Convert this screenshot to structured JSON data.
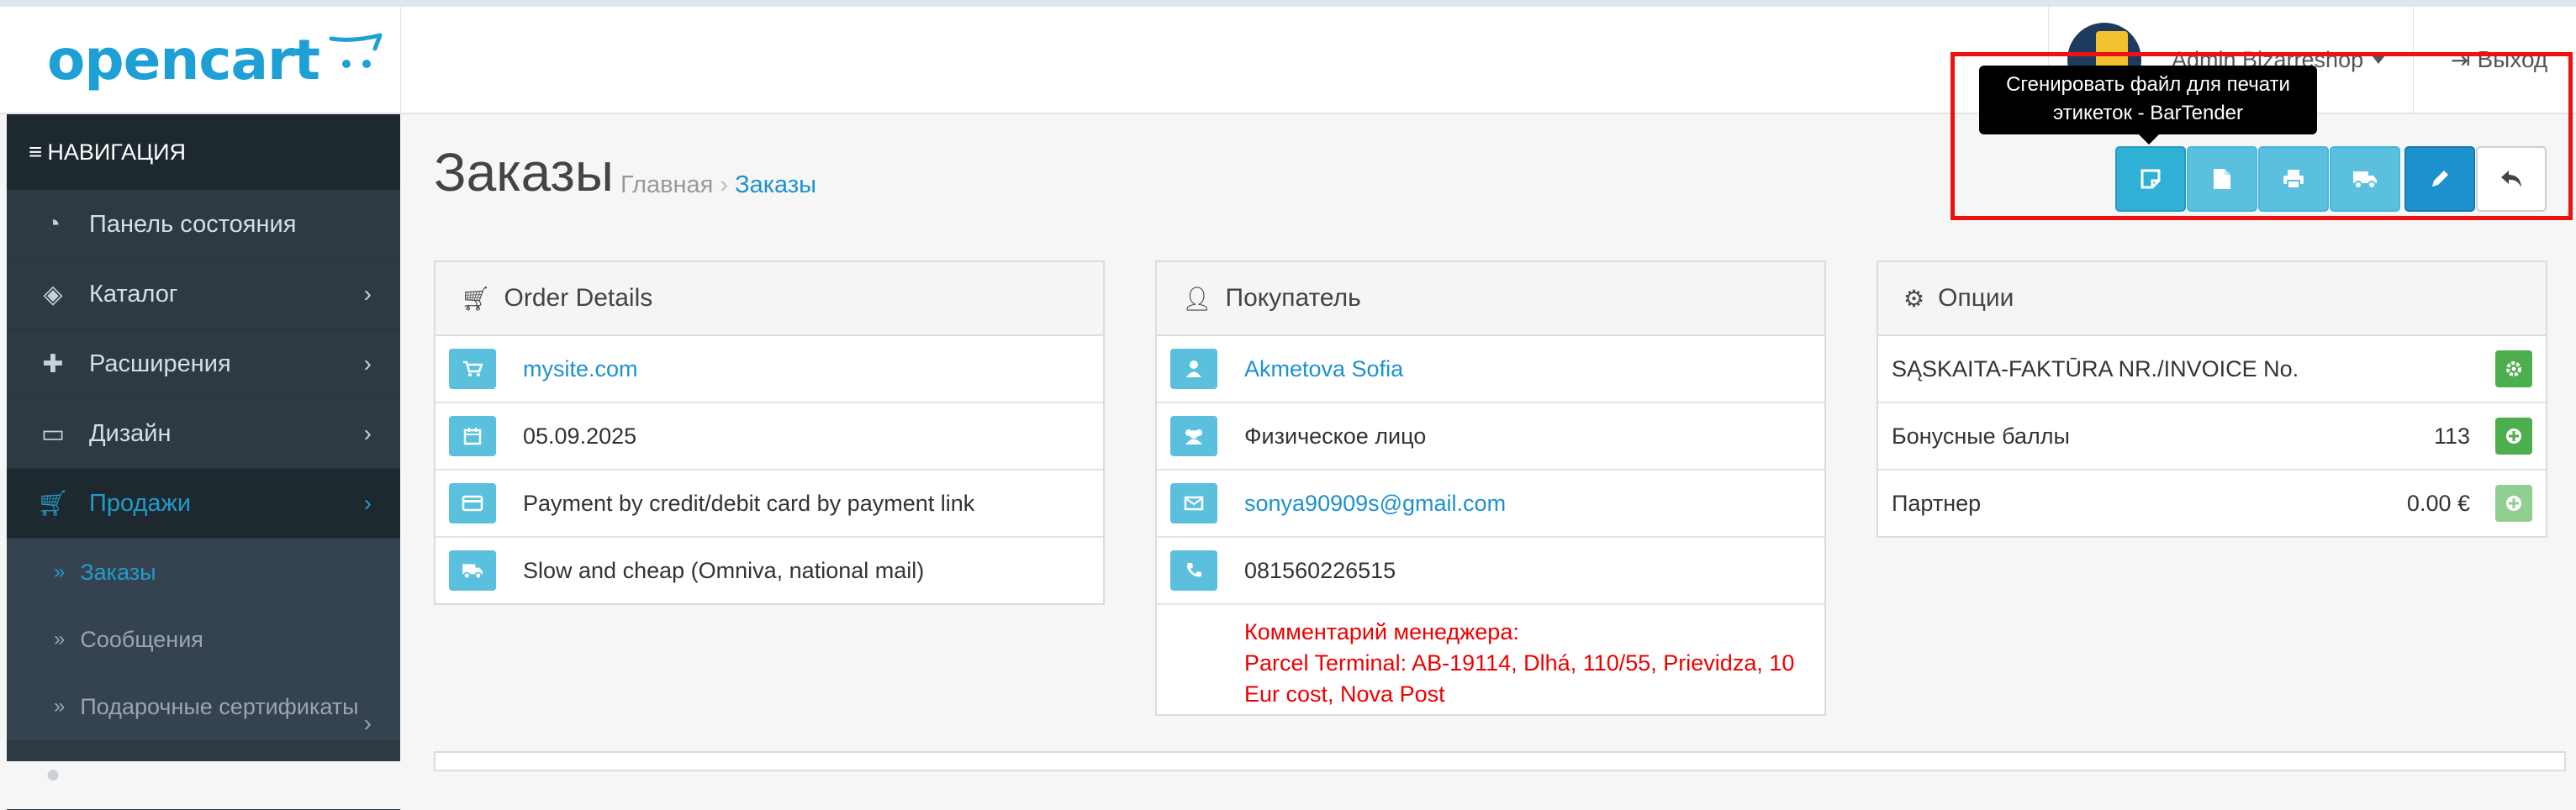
{
  "header": {
    "logo_text": "opencart",
    "user_name": "Admin Bizarreshop",
    "logout_label": "Выход"
  },
  "sidebar": {
    "heading": "НАВИГАЦИЯ",
    "items": [
      {
        "label": "Панель состояния",
        "icon": "dashboard-icon"
      },
      {
        "label": "Каталог",
        "icon": "tags-icon"
      },
      {
        "label": "Расширения",
        "icon": "puzzle-icon"
      },
      {
        "label": "Дизайн",
        "icon": "monitor-icon"
      },
      {
        "label": "Продажи",
        "icon": "cart-icon"
      }
    ],
    "sub_items": [
      {
        "label": "Заказы"
      },
      {
        "label": "Сообщения"
      },
      {
        "label": "Подарочные сертификаты"
      }
    ]
  },
  "page": {
    "title": "Заказы",
    "breadcrumb": [
      "Главная",
      "Заказы"
    ]
  },
  "tooltip": "Сгенировать файл для печати этикеток - BarTender",
  "order_details": {
    "heading": "Order Details",
    "store": "mysite.com",
    "date": "05.09.2025",
    "payment": "Payment by credit/debit card by payment link",
    "shipping": "Slow and cheap (Omniva, national mail)"
  },
  "customer": {
    "heading": "Покупатель",
    "name": "Akmetova Sofia",
    "group": "Физическое лицо",
    "email": "sonya90909s@gmail.com",
    "phone": "081560226515",
    "comment_lines": [
      "Комментарий менеджера:",
      "Parcel Terminal: AB-19114, Dlhá, 110/55, Prievidza, 10",
      "Eur cost, Nova Post"
    ]
  },
  "options": {
    "heading": "Опции",
    "invoice_label": "SĄSKAITA-FAKTŪRA NR./INVOICE No.",
    "reward_label": "Бонусные баллы",
    "reward_value": "113",
    "affiliate_label": "Партнер",
    "affiliate_value": "0.00 €"
  }
}
